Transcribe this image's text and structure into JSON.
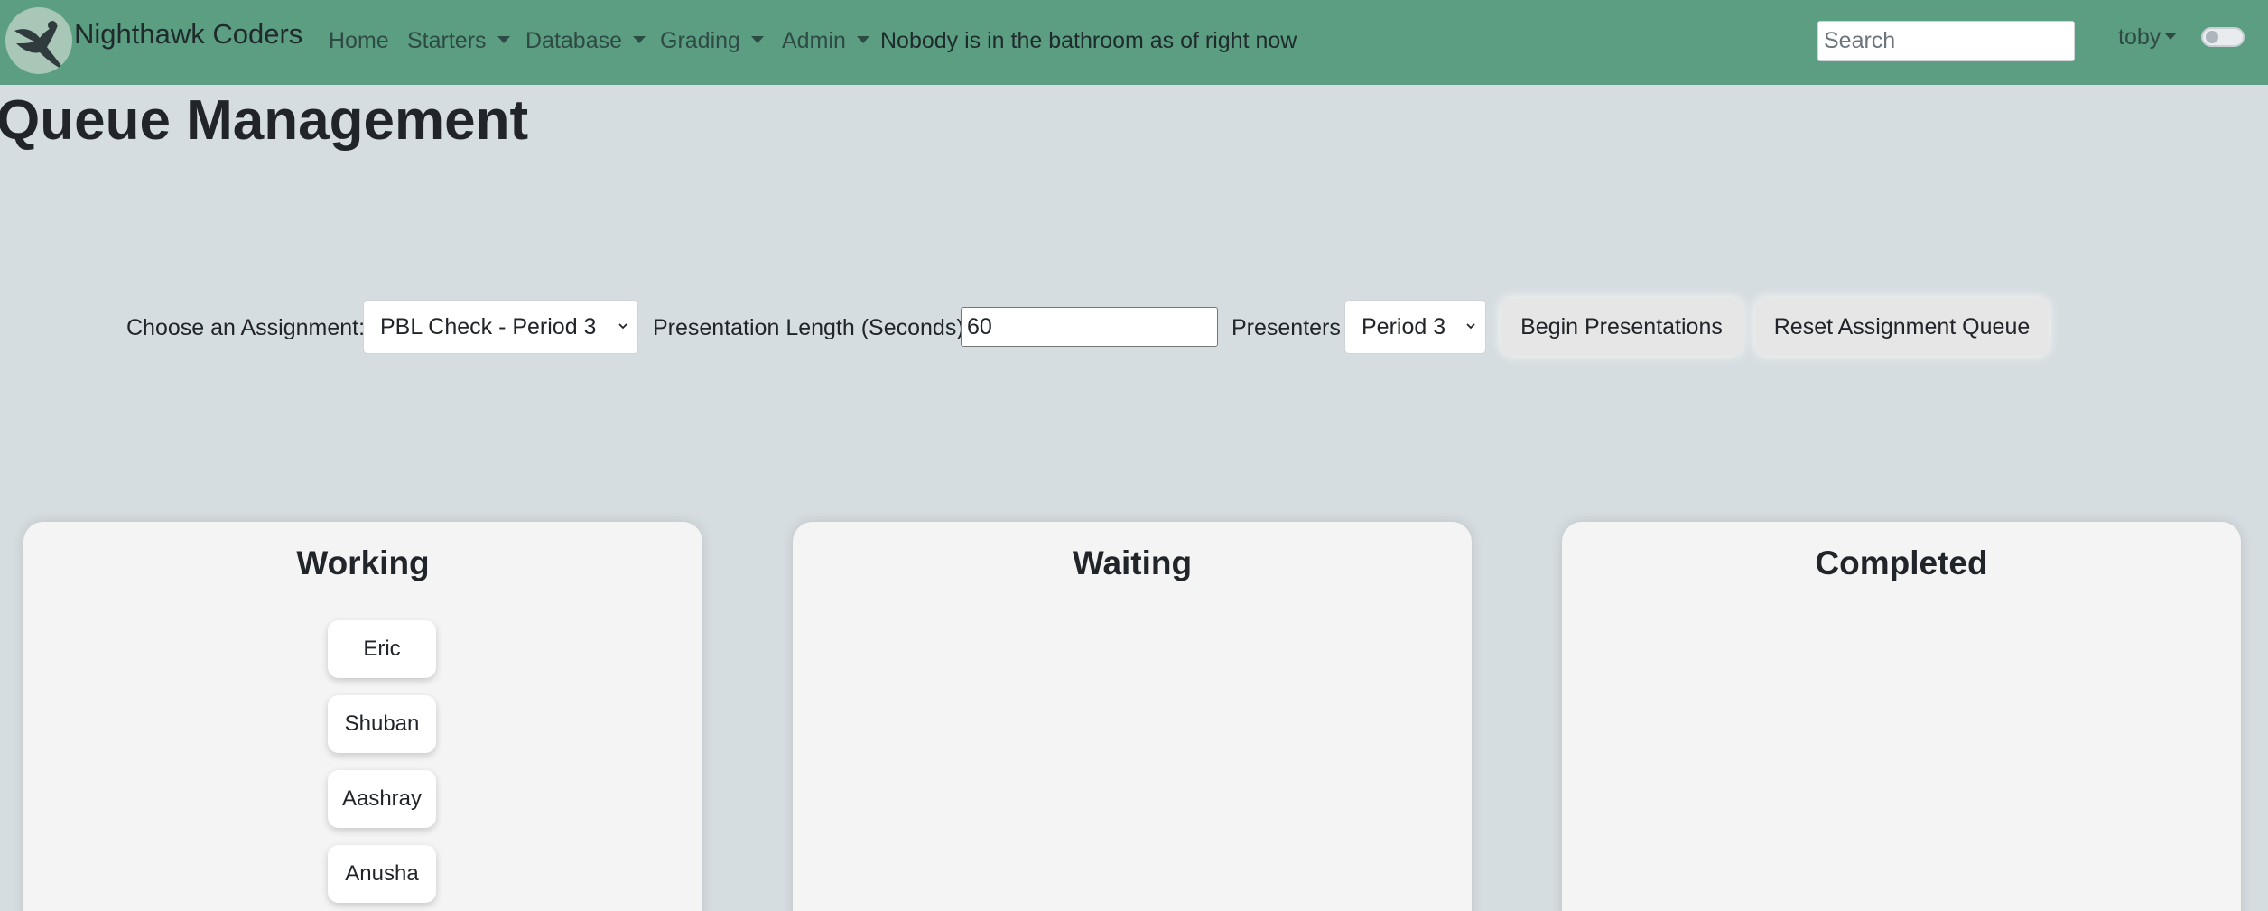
{
  "navbar": {
    "brand": "Nighthawk Coders",
    "items": [
      "Home",
      "Starters",
      "Database",
      "Grading",
      "Admin"
    ],
    "bathroom_status": "Nobody is in the bathroom as of right now",
    "search_placeholder": "Search",
    "user": "toby"
  },
  "page": {
    "title": "Queue Management"
  },
  "controls": {
    "assignment_label": "Choose an Assignment:",
    "assignment_value": "PBL Check - Period 3",
    "length_label": "Presentation Length (Seconds):",
    "length_value": "60",
    "presenters_label": "Presenters",
    "presenters_value": "Period 3",
    "begin_button": "Begin Presentations",
    "reset_button": "Reset Assignment Queue"
  },
  "columns": [
    {
      "title": "Working",
      "cards": [
        "Eric",
        "Shuban",
        "Aashray",
        "Anusha"
      ]
    },
    {
      "title": "Waiting",
      "cards": []
    },
    {
      "title": "Completed",
      "cards": []
    }
  ],
  "colors": {
    "navbar": "#5c9e82",
    "background": "#d6dde0",
    "column": "#f4f4f4"
  }
}
